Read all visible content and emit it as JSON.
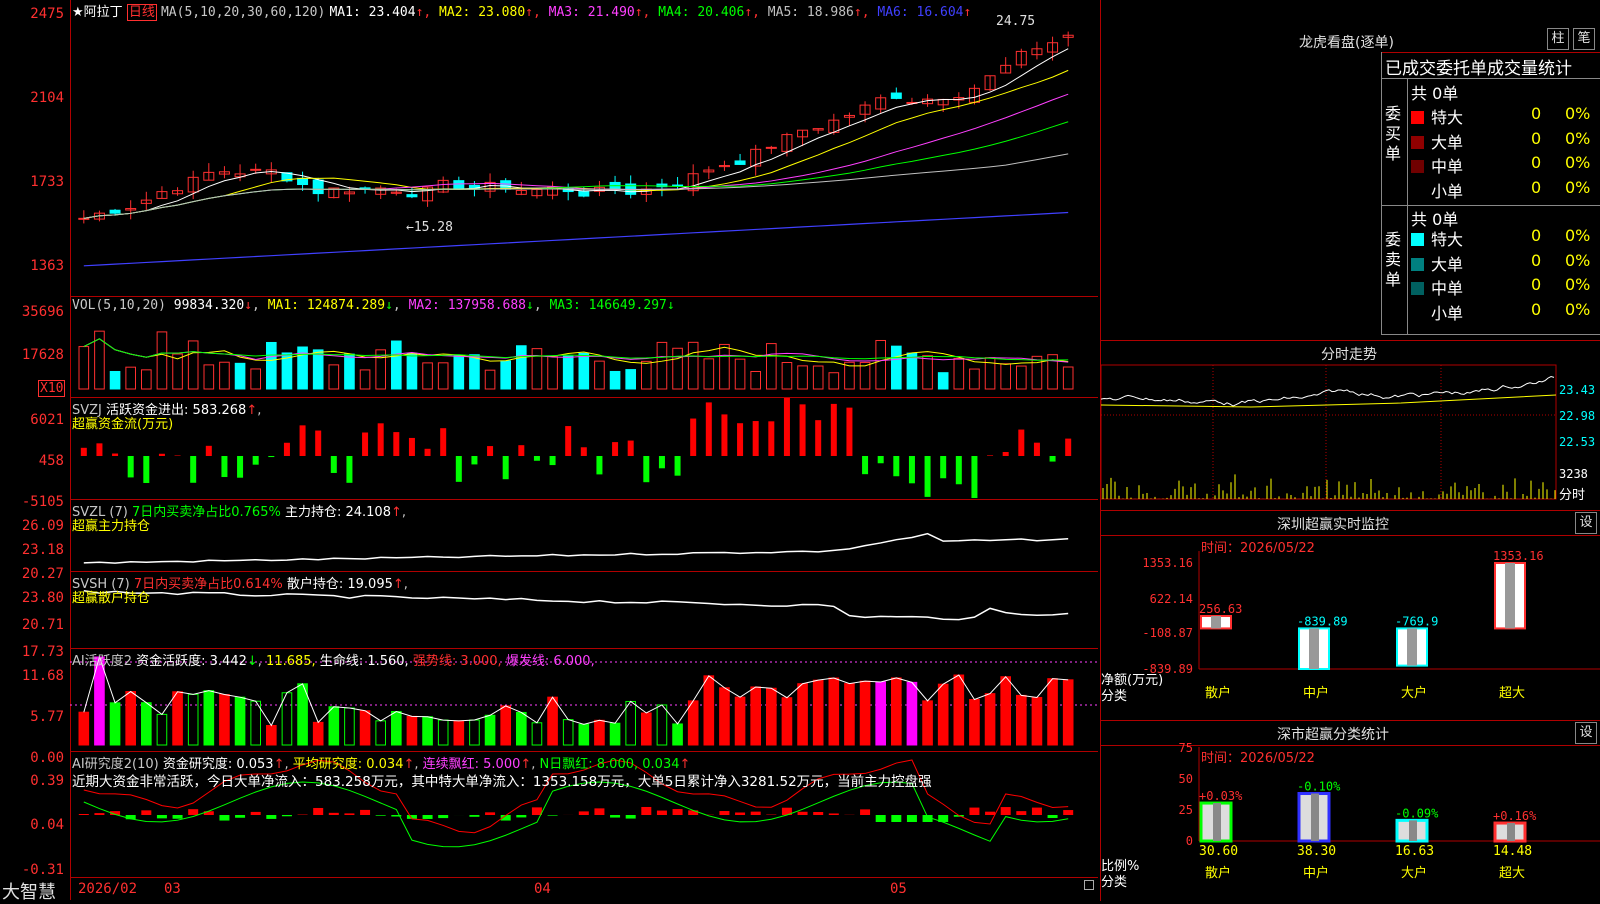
{
  "stock": {
    "star": "★",
    "name": "阿拉丁",
    "period": "日线",
    "ma_label": "MA(5,10,20,30,60,120)",
    "ma": [
      {
        "label": "MA1:",
        "value": "23.404",
        "color": "#ffffff"
      },
      {
        "label": "MA2:",
        "value": "23.080",
        "color": "#ffff00"
      },
      {
        "label": "MA3:",
        "value": "21.490",
        "color": "#ff40ff"
      },
      {
        "label": "MA4:",
        "value": "20.406",
        "color": "#00ff00"
      },
      {
        "label": "MA5:",
        "value": "18.986",
        "color": "#c0c0c0"
      },
      {
        "label": "MA6:",
        "value": "16.604",
        "color": "#4040ff"
      }
    ],
    "arrow_up": "↑",
    "arrow_down": "↓",
    "high_mark": "24.75",
    "low_mark": "←15.28"
  },
  "axes": {
    "price": [
      "2475",
      "2104",
      "1733",
      "1363"
    ],
    "vol": [
      "35696",
      "17628"
    ],
    "vol_unit": "X10",
    "svzj": [
      "6021",
      "458",
      "-5105"
    ],
    "svzl": [
      "26.09",
      "23.18",
      "20.27"
    ],
    "svsh": [
      "23.80",
      "20.71",
      "17.73"
    ],
    "ai1": [
      "11.68",
      "5.77",
      "0.00"
    ],
    "ai2": [
      "0.39",
      "0.04",
      "-0.31"
    ],
    "dates": [
      "2026/02",
      "03",
      "04",
      "05"
    ],
    "brand": "大智慧"
  },
  "vol_panel": {
    "title": "VOL(5,10,20)",
    "v0": "99834.320",
    "ma1": "MA1: 124874.289",
    "ma2": "MA2: 137958.688",
    "ma3": "MA3: 146649.297"
  },
  "svzj_panel": {
    "title": "SVZJ",
    "line1": "活跃资金进出: 583.268",
    "line2": "超赢资金流(万元)"
  },
  "svzl_panel": {
    "title": "SVZL (7)",
    "ratio": "7日内买卖净占比0.765%",
    "hold": "主力持仓: 24.108",
    "sub": "超赢主力持仓"
  },
  "svsh_panel": {
    "title": "SVSH (7)",
    "ratio": "7日内买卖净占比0.614%",
    "hold": "散户持仓: 19.095",
    "sub": "超赢散户持仓"
  },
  "ai1_panel": {
    "title": "AI活跃度2",
    "act": "资金活跃度: 3.442",
    "v2": "11.685,",
    "life": "生命线: 1.560,",
    "strong": "强势线: 3.000,",
    "burst": "爆发线: 6.000,"
  },
  "ai2_panel": {
    "title": "AI研究度2(10)",
    "research": "资金研究度: 0.053",
    "avg": "平均研究度: 0.034",
    "cont": "连续飘红: 5.000",
    "nday": "N日飘红: 8.000, 0.034",
    "comment": "近期大资金非常活跃，今日大单净流入：583.258万元，其中特大单净流入：1353.158万元，大单5日累计净入3281.52万元，当前主力控盘强"
  },
  "lhb": {
    "title": "龙虎看盘(逐单)",
    "btn1": "柱",
    "btn2": "笔",
    "tabs": "已成交委托单成交量统计",
    "buy_side": "委买单",
    "sell_side": "委卖单",
    "buy_total": "共 0单",
    "sell_total": "共 0单",
    "buy_rows": [
      {
        "name": "特大",
        "val": "0",
        "pct": "0%",
        "color": "#ff0000"
      },
      {
        "name": "大单",
        "val": "0",
        "pct": "0%",
        "color": "#900000"
      },
      {
        "name": "中单",
        "val": "0",
        "pct": "0%",
        "color": "#700000"
      },
      {
        "name": "小单",
        "val": "0",
        "pct": "0%",
        "color": "#000000"
      }
    ],
    "sell_rows": [
      {
        "name": "特大",
        "val": "0",
        "pct": "0%",
        "color": "#00ffff"
      },
      {
        "name": "大单",
        "val": "0",
        "pct": "0%",
        "color": "#008080"
      },
      {
        "name": "中单",
        "val": "0",
        "pct": "0%",
        "color": "#006060"
      },
      {
        "name": "小单",
        "val": "0",
        "pct": "0%",
        "color": "#000000"
      }
    ]
  },
  "intraday": {
    "title": "分时走势",
    "prices": [
      "23.43",
      "22.98",
      "22.53"
    ],
    "vol_label": "3238",
    "unit": "分时"
  },
  "sz_monitor": {
    "title": "深圳超赢实时监控",
    "btn": "设",
    "time": "时间：2026/05/22",
    "ylabels": [
      "1353.16",
      "622.14",
      "-108.87",
      "-839.89"
    ],
    "unit1": "净额(万元)",
    "unit2": "分类",
    "bars": [
      {
        "label": "256.63",
        "cat": "散户"
      },
      {
        "label": "-839.89",
        "cat": "中户"
      },
      {
        "label": "-769.9",
        "cat": "大户"
      },
      {
        "label": "1353.16",
        "cat": "超大"
      }
    ]
  },
  "sz_class": {
    "title": "深市超赢分类统计",
    "btn": "设",
    "time": "时间：2026/05/22",
    "ylabels": [
      "75",
      "50",
      "25",
      "0"
    ],
    "unit1": "比例%",
    "unit2": "分类",
    "bars": [
      {
        "pct": "+0.03%",
        "val": "30.60",
        "cat": "散户"
      },
      {
        "pct": "-0.10%",
        "val": "38.30",
        "cat": "中户"
      },
      {
        "pct": "-0.09%",
        "val": "16.63",
        "cat": "大户"
      },
      {
        "pct": "+0.16%",
        "val": "14.48",
        "cat": "超大"
      }
    ]
  },
  "chart_data": {
    "type": "bar",
    "title": "深圳超赢实时监控",
    "categories": [
      "散户",
      "中户",
      "大户",
      "超大"
    ],
    "series": [
      {
        "name": "净额(万元)",
        "values": [
          256.63,
          -839.89,
          -769.9,
          1353.16
        ]
      }
    ],
    "ylim": [
      -839.89,
      1353.16
    ]
  }
}
